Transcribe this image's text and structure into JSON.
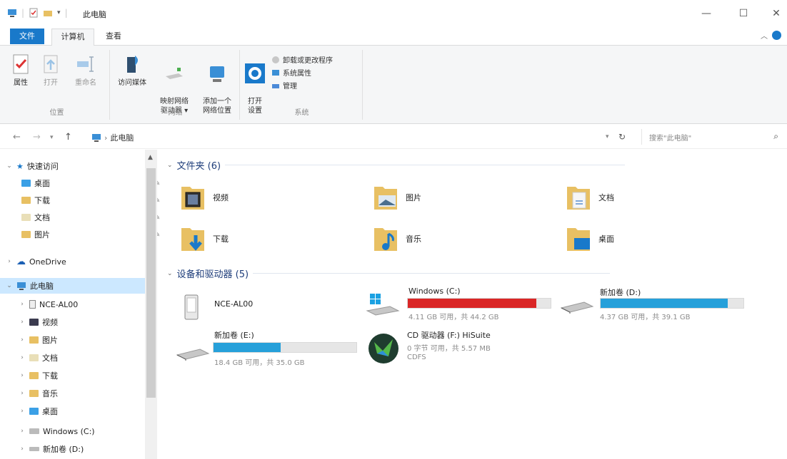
{
  "window": {
    "title": "此电脑",
    "controls": {
      "minimize": "—",
      "maximize": "☐",
      "close": "✕"
    }
  },
  "ribbon": {
    "tabs": [
      "文件",
      "计算机",
      "查看"
    ],
    "groups": {
      "location": {
        "label": "位置",
        "buttons": [
          "属性",
          "打开",
          "重命名"
        ]
      },
      "network": {
        "label": "网络",
        "buttons": [
          "访问媒体",
          "映射网络\n驱动器 ▾",
          "添加一个\n网络位置"
        ]
      },
      "system": {
        "label": "系统",
        "open_settings": "打开\n设置",
        "small_buttons": [
          "卸载或更改程序",
          "系统属性",
          "管理"
        ]
      }
    }
  },
  "address": {
    "breadcrumb": "此电脑",
    "search_placeholder": "搜索\"此电脑\""
  },
  "sidebar": {
    "quick_access": "快速访问",
    "quick_items": [
      "桌面",
      "下载",
      "文档",
      "图片"
    ],
    "onedrive": "OneDrive",
    "this_pc": "此电脑",
    "pc_items": [
      "NCE-AL00",
      "视频",
      "图片",
      "文档",
      "下载",
      "音乐",
      "桌面",
      "Windows (C:)",
      "新加卷 (D:)"
    ]
  },
  "content": {
    "folders_header": "文件夹 (6)",
    "folders": [
      "视频",
      "图片",
      "文档",
      "下载",
      "音乐",
      "桌面"
    ],
    "devices_header": "设备和驱动器 (5)",
    "devices": [
      {
        "name": "NCE-AL00",
        "info": "",
        "extra": "",
        "used_fraction": null,
        "bar_color": ""
      },
      {
        "name": "Windows (C:)",
        "info": "4.11 GB 可用，共 44.2 GB",
        "extra": "",
        "used_fraction": 0.9,
        "bar_color": "#da2626"
      },
      {
        "name": "新加卷 (D:)",
        "info": "4.37 GB 可用，共 39.1 GB",
        "extra": "",
        "used_fraction": 0.89,
        "bar_color": "#26a0da"
      },
      {
        "name": "新加卷 (E:)",
        "info": "18.4 GB 可用，共 35.0 GB",
        "extra": "",
        "used_fraction": 0.47,
        "bar_color": "#26a0da"
      },
      {
        "name": "CD 驱动器 (F:) HiSuite",
        "info": "0 字节 可用，共 5.57 MB",
        "extra": "CDFS",
        "used_fraction": null,
        "bar_color": ""
      }
    ]
  }
}
